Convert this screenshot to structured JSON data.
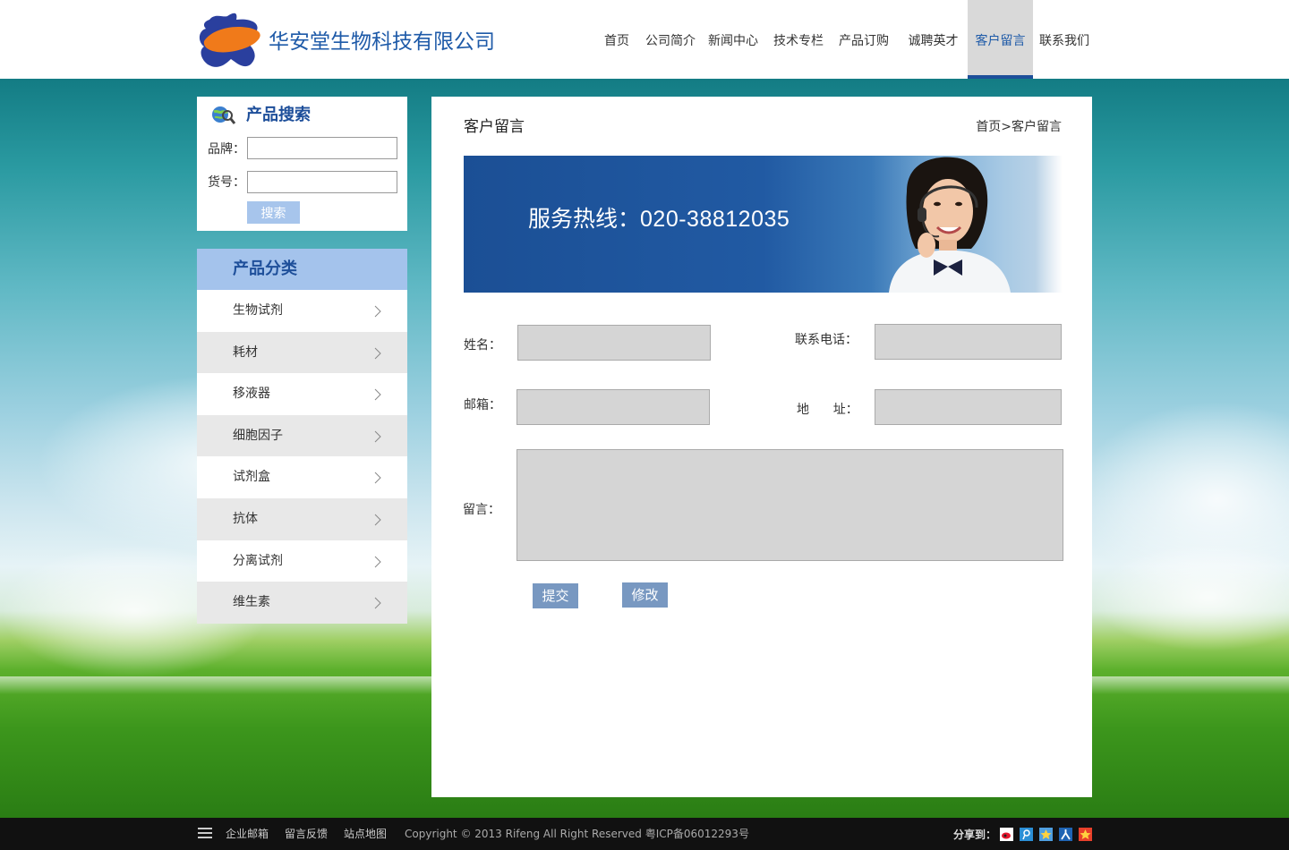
{
  "header": {
    "company_name": "华安堂生物科技有限公司",
    "nav": [
      {
        "label": "首页"
      },
      {
        "label": "公司简介"
      },
      {
        "label": "新闻中心"
      },
      {
        "label": "技术专栏"
      },
      {
        "label": "产品订购"
      },
      {
        "label": "诚聘英才"
      },
      {
        "label": "客户留言",
        "active": true
      },
      {
        "label": "联系我们"
      }
    ]
  },
  "search": {
    "title": "产品搜索",
    "brand_label": "品牌：",
    "item_no_label": "货号：",
    "brand_value": "",
    "item_no_value": "",
    "button": "搜索"
  },
  "categories": {
    "title": "产品分类",
    "items": [
      {
        "label": "生物试剂"
      },
      {
        "label": "耗材"
      },
      {
        "label": "移液器"
      },
      {
        "label": "细胞因子"
      },
      {
        "label": "试剂盒"
      },
      {
        "label": "抗体"
      },
      {
        "label": "分离试剂"
      },
      {
        "label": "维生素"
      }
    ]
  },
  "main": {
    "title": "客户留言",
    "breadcrumb": "首页>客户留言",
    "banner": {
      "hotline_label": "服务热线：",
      "hotline_number": "020-38812035"
    },
    "form": {
      "name_label": "姓名：",
      "phone_label": "联系电话：",
      "email_label": "邮箱：",
      "address_label": "地      址：",
      "message_label": "留言：",
      "name_value": "",
      "phone_value": "",
      "email_value": "",
      "address_value": "",
      "message_value": "",
      "submit_button": "提交",
      "modify_button": "修改"
    }
  },
  "footer": {
    "links": [
      "企业邮箱",
      "留言反馈",
      "站点地图"
    ],
    "copyright": "Copyright © 2013 Rifeng All Right Reserved 粤ICP备06012293号",
    "share_label": "分享到：",
    "share_icons": [
      "weibo-icon",
      "tencent-weibo-icon",
      "qzone-icon",
      "renren-icon",
      "favorite-star-icon"
    ]
  },
  "colors": {
    "brand_blue": "#1e5aa8",
    "nav_active_bg": "#d9d9d9",
    "nav_active_border": "#1e4f9a",
    "category_header_bg": "#a4c3ec",
    "form_field_bg": "#d5d5d5",
    "form_button_bg": "#7898c1",
    "search_button_bg": "#a7c5ec",
    "footer_bg": "#111111"
  }
}
